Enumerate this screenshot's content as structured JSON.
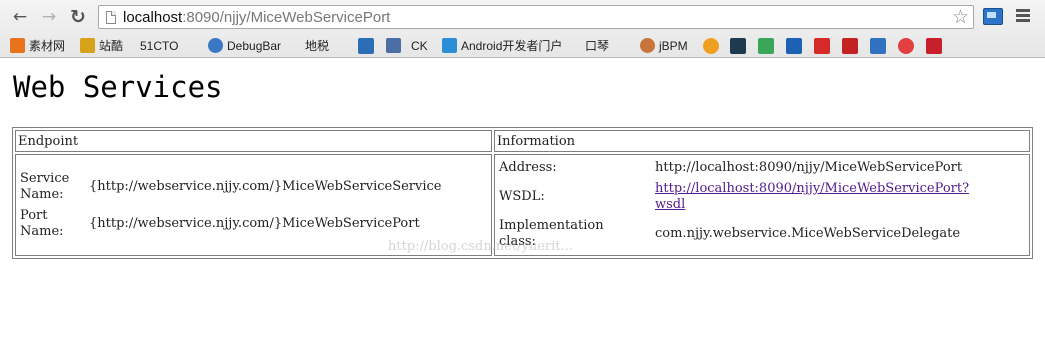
{
  "browser": {
    "url_host": "localhost",
    "url_rest": ":8090/njjy/MiceWebServicePort",
    "back_glyph": "←",
    "forward_glyph": "→",
    "reload_glyph": "↻",
    "star_glyph": "☆",
    "bookmarks": [
      {
        "label": "素材网",
        "icon": "orange-puzzle-icon",
        "color": "#e8731b"
      },
      {
        "label": "站酷",
        "icon": "zcool-icon",
        "color": "#d6a21a"
      },
      {
        "label": "51CTO",
        "icon": "page-icon",
        "color": "#ffffff"
      },
      {
        "label": "DebugBar",
        "icon": "debugbar-icon",
        "color": "#3b78c4"
      },
      {
        "label": "地税",
        "icon": "page-icon",
        "color": "#ffffff"
      },
      {
        "label": "",
        "icon": "c-blue-icon",
        "color": "#2d6db5"
      },
      {
        "label": "CK",
        "icon": "ck-icon",
        "color": "#4a6fa5"
      },
      {
        "label": "Android开发者门户",
        "icon": "android-portal-icon",
        "color": "#2a8fd6"
      },
      {
        "label": "口琴",
        "icon": "page-icon",
        "color": "#ffffff"
      },
      {
        "label": "jBPM",
        "icon": "jbpm-icon",
        "color": "#c8743a"
      }
    ],
    "icon_only_bookmarks": [
      {
        "icon": "orange-swirl-icon",
        "color": "#f0a020"
      },
      {
        "icon": "dark-mascot-icon",
        "color": "#1f3a4d"
      },
      {
        "icon": "green-chat-icon",
        "color": "#3aa657"
      },
      {
        "icon": "xun-icon",
        "color": "#1b62b4"
      },
      {
        "icon": "jd-icon",
        "color": "#d42a2a"
      },
      {
        "icon": "red-chart-icon",
        "color": "#c22222"
      },
      {
        "icon": "g-blue-icon",
        "color": "#3271c0"
      },
      {
        "icon": "weibo-icon",
        "color": "#e24040"
      },
      {
        "icon": "c-red-icon",
        "color": "#c8202a"
      }
    ]
  },
  "page": {
    "title": "Web Services",
    "table": {
      "header_endpoint": "Endpoint",
      "header_information": "Information",
      "service_name_label_1": "Service",
      "service_name_label_2": "Name:",
      "service_name_value": "{http://webservice.njjy.com/}MiceWebServiceService",
      "port_name_label_1": "Port",
      "port_name_label_2": "Name:",
      "port_name_value": "{http://webservice.njjy.com/}MiceWebServicePort",
      "address_label": "Address:",
      "address_value": "http://localhost:8090/njjy/MiceWebServicePort",
      "wsdl_label": "WSDL:",
      "wsdl_link_line1": "http://localhost:8090/njjy/MiceWebServicePort?",
      "wsdl_link_line2": "wsdl",
      "impl_label_1": "Implementation",
      "impl_label_2": "class:",
      "impl_value": "com.njjy.webservice.MiceWebServiceDelegate"
    },
    "watermark": "http://blog.csdn.net/yuerit..."
  },
  "colors": {
    "visited_link": "#551a8b",
    "highlight_box": "#dd3333"
  }
}
